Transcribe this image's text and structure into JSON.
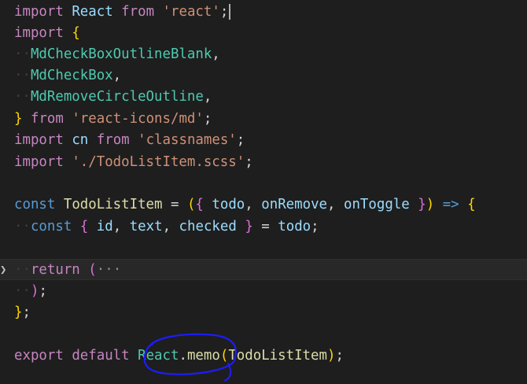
{
  "editor": {
    "lines": {
      "l1": {
        "t1": "import",
        "t2": "React",
        "t3": "from",
        "t4": "'react'",
        "t5": ";"
      },
      "l2": {
        "t1": "import",
        "t2": "{"
      },
      "l3": {
        "t1": "MdCheckBoxOutlineBlank",
        "t2": ","
      },
      "l4": {
        "t1": "MdCheckBox",
        "t2": ","
      },
      "l5": {
        "t1": "MdRemoveCircleOutline",
        "t2": ","
      },
      "l6": {
        "t1": "}",
        "t2": "from",
        "t3": "'react-icons/md'",
        "t4": ";"
      },
      "l7": {
        "t1": "import",
        "t2": "cn",
        "t3": "from",
        "t4": "'classnames'",
        "t5": ";"
      },
      "l8": {
        "t1": "import",
        "t2": "'./TodoListItem.scss'",
        "t3": ";"
      },
      "l10": {
        "t1": "const",
        "t2": "TodoListItem",
        "t3": "=",
        "t4": "(",
        "t5": "{",
        "t6": "todo",
        "t7": ",",
        "t8": "onRemove",
        "t9": ",",
        "t10": "onToggle",
        "t11": "}",
        "t12": ")",
        "t13": "=>",
        "t14": "{"
      },
      "l11": {
        "t1": "const",
        "t2": "{",
        "t3": "id",
        "t4": ",",
        "t5": "text",
        "t6": ",",
        "t7": "checked",
        "t8": "}",
        "t9": "=",
        "t10": "todo",
        "t11": ";"
      },
      "l13": {
        "t1": "return",
        "t2": "(",
        "t3": "···"
      },
      "l14": {
        "t1": ")",
        "t2": ";"
      },
      "l15": {
        "t1": "}",
        "t2": ";"
      },
      "l17": {
        "t1": "export",
        "t2": "default",
        "t3": "React",
        "t4": ".",
        "t5": "memo",
        "t6": "(",
        "t7": "TodoListItem",
        "t8": ")",
        "t9": ";"
      }
    }
  },
  "colors": {
    "background": "#1e1e1e",
    "keyword_control": "#c586c0",
    "keyword_storage": "#569cd6",
    "variable": "#9cdcfe",
    "function": "#dcdcaa",
    "class": "#4ec9b0",
    "string": "#ce9178",
    "annotation_pen": "#1c1cff"
  },
  "icons": {
    "fold": "chevron-right-icon"
  }
}
